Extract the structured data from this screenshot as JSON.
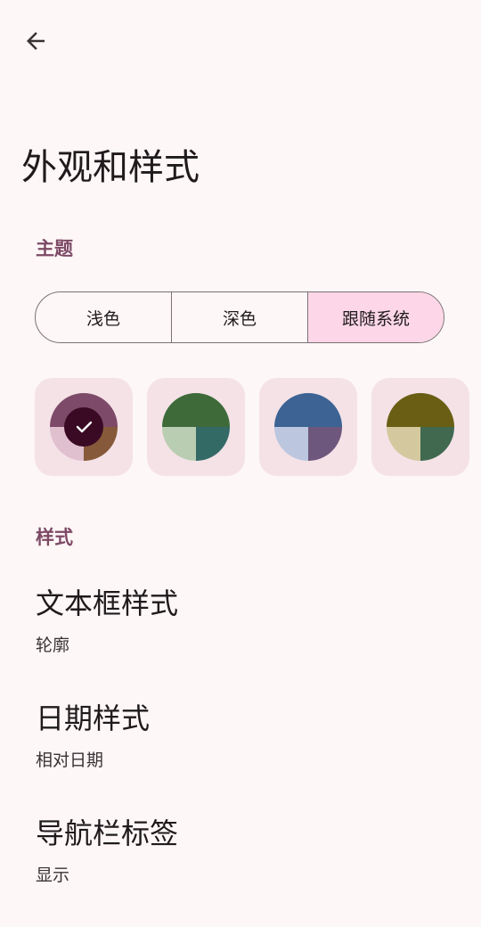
{
  "page": {
    "title": "外观和样式"
  },
  "theme_section": {
    "header": "主题",
    "modes": [
      {
        "label": "浅色",
        "selected": false
      },
      {
        "label": "深色",
        "selected": false
      },
      {
        "label": "跟随系统",
        "selected": true
      }
    ],
    "color_palettes": [
      {
        "name": "pink-palette",
        "primary": "#7e4a69",
        "secondary": "#e0bfcf",
        "tertiary": "#86593a",
        "selected": true,
        "check_bg": "#3a0a25"
      },
      {
        "name": "green-palette",
        "primary": "#3e6a3a",
        "secondary": "#b9cdb2",
        "tertiary": "#336a66",
        "selected": false
      },
      {
        "name": "blue-palette",
        "primary": "#3c6393",
        "secondary": "#bcc7df",
        "tertiary": "#6d577c",
        "selected": false
      },
      {
        "name": "olive-palette",
        "primary": "#6a5e14",
        "secondary": "#d4c89f",
        "tertiary": "#416950",
        "selected": false
      }
    ]
  },
  "style_section": {
    "header": "样式",
    "items": [
      {
        "title": "文本框样式",
        "summary": "轮廓"
      },
      {
        "title": "日期样式",
        "summary": "相对日期"
      },
      {
        "title": "导航栏标签",
        "summary": "显示"
      }
    ]
  },
  "colors": {
    "background": "#fdf7f7",
    "accent": "#7d4a66",
    "segment_selected": "#fdd7e7",
    "card_background": "#f4e2e7"
  }
}
